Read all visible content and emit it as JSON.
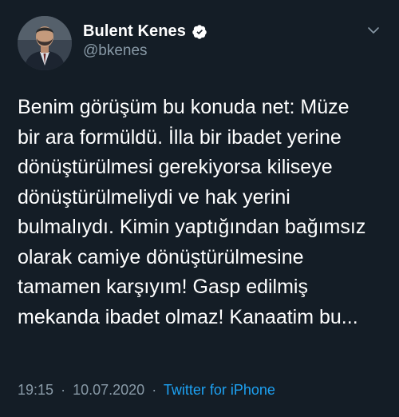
{
  "user": {
    "display_name": "Bulent Kenes",
    "handle": "@bkenes",
    "verified_icon": "verified-badge-icon",
    "avatar_icon": "profile-photo"
  },
  "tweet": {
    "lines": [
      "Benim görüşüm bu konuda net: Müze",
      "bir ara formüldü. İlla bir ibadet yerine",
      "dönüştürülmesi gerekiyorsa kiliseye",
      "dönüştürülmeliydi ve hak yerini",
      "bulmalıydı. Kimin yaptığından bağımsız",
      "olarak camiye dönüştürülmesine",
      "tamamen karşıyım! Gasp edilmiş",
      "mekanda ibadet olmaz! Kanaatim bu..."
    ]
  },
  "meta": {
    "time": "19:15",
    "separator": "·",
    "date": "10.07.2020",
    "source": "Twitter for iPhone"
  },
  "menu_icon": "chevron-down-icon",
  "colors": {
    "background": "#141d26",
    "text": "#ffffff",
    "secondary": "#8899a6",
    "link": "#1da1f2"
  }
}
